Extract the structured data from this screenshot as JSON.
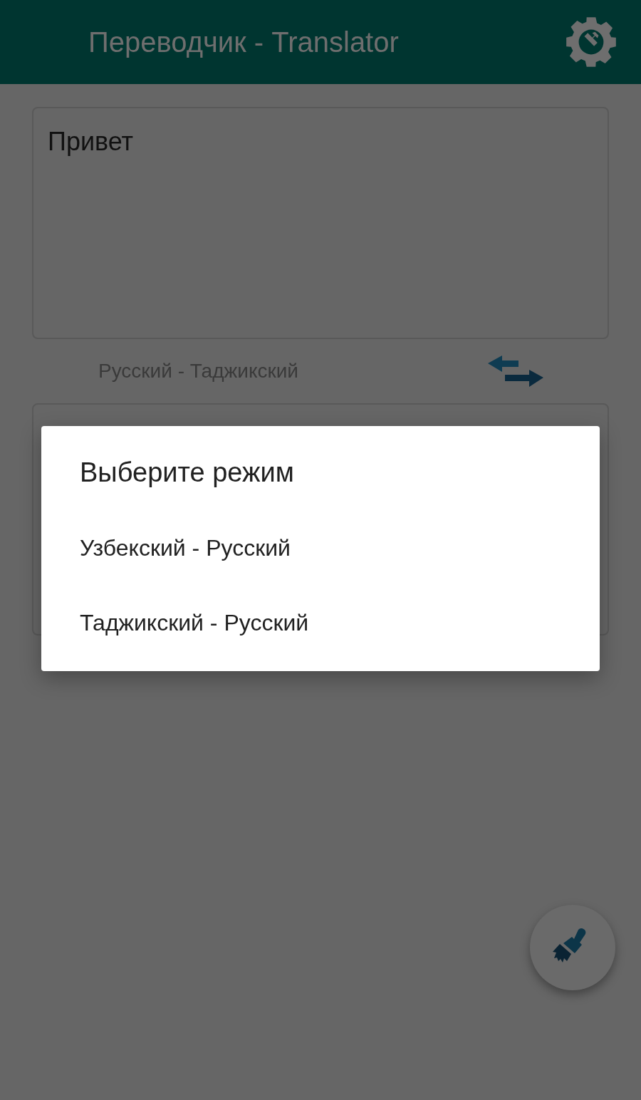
{
  "app_bar": {
    "title": "Переводчик - Translator"
  },
  "input": {
    "value": "Привет"
  },
  "language_pair": "Русский - Таджикский",
  "dialog": {
    "title": "Выберите режим",
    "options": [
      "Узбекский - Русский",
      "Таджикский - Русский"
    ]
  }
}
